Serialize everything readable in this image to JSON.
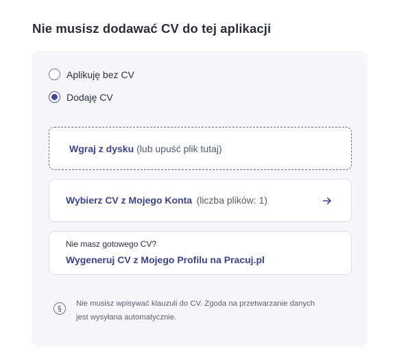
{
  "heading": "Nie musisz dodawać CV do tej aplikacji",
  "options": [
    {
      "label": "Aplikuję bez CV",
      "selected": false
    },
    {
      "label": "Dodaję CV",
      "selected": true
    }
  ],
  "upload": {
    "action_label": "Wgraj z dysku",
    "hint": "(lub upuść plik tutaj)"
  },
  "choose": {
    "action_label": "Wybierz CV z Mojego Konta",
    "hint": "(liczba plików: 1)",
    "icon": "arrow-right-icon"
  },
  "generate": {
    "caption": "Nie masz gotowego CV?",
    "link_label": "Wygeneruj CV z Mojego Profilu na Pracuj.pl"
  },
  "notice": {
    "icon_glyph": "§",
    "line1": "Nie musisz wpisywać klauzuli do CV. Zgoda na przetwarzanie danych",
    "line2": "jest wysyłana automatycznie."
  },
  "colors": {
    "accent": "#3a4292",
    "panel_bg": "#f7f7fb",
    "dashed_border": "#5e65a7"
  }
}
